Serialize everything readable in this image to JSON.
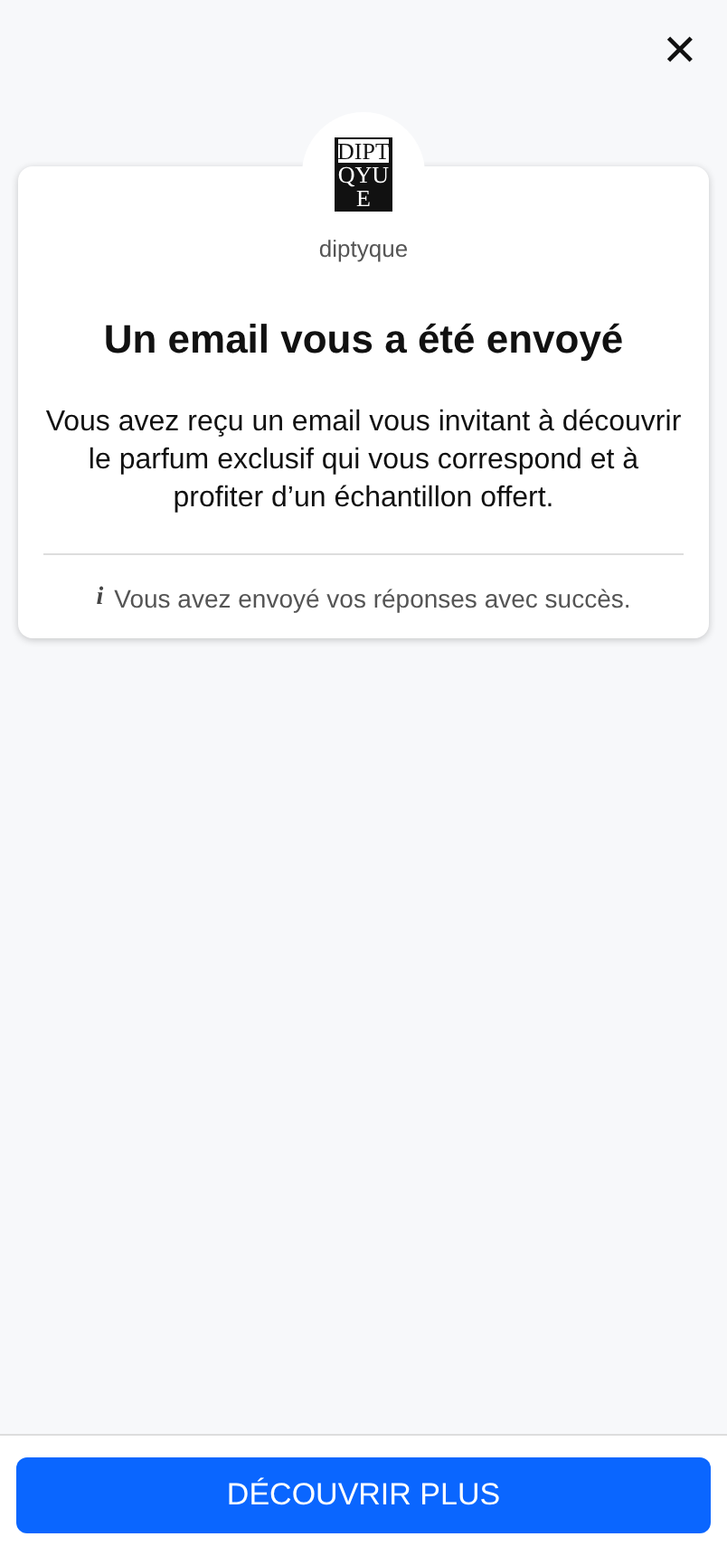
{
  "close_button": {
    "label": "✕"
  },
  "brand": {
    "logo_lines": [
      "DIPT",
      "QYU",
      "E"
    ],
    "name": "diptyque"
  },
  "card": {
    "title": "Un email vous a été envoyé",
    "message": "Vous avez reçu un email vous invitant à découvrir le parfum exclusif qui vous correspond et à profiter d’un échantillon offert.",
    "info_icon": "i",
    "info": "Vous avez envoyé vos réponses avec succès."
  },
  "footer": {
    "button": "DÉCOUVRIR PLUS"
  }
}
